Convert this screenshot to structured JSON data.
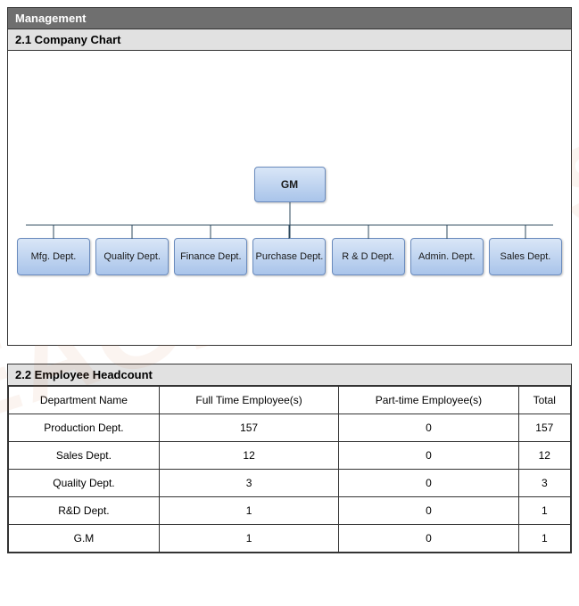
{
  "header": {
    "title": "Management"
  },
  "section_chart": {
    "title": "2.1 Company Chart",
    "root": "GM",
    "children": [
      "Mfg. Dept.",
      "Quality Dept.",
      "Finance Dept.",
      "Purchase Dept.",
      "R & D Dept.",
      "Admin. Dept.",
      "Sales Dept."
    ]
  },
  "section_headcount": {
    "title": "2.2 Employee Headcount",
    "columns": [
      "Department Name",
      "Full Time Employee(s)",
      "Part-time Employee(s)",
      "Total"
    ],
    "rows": [
      {
        "dept": "Production Dept.",
        "full": 157,
        "part": 0,
        "total": 157
      },
      {
        "dept": "Sales Dept.",
        "full": 12,
        "part": 0,
        "total": 12
      },
      {
        "dept": "Quality Dept.",
        "full": 3,
        "part": 0,
        "total": 3
      },
      {
        "dept": "R&D Dept.",
        "full": 1,
        "part": 0,
        "total": 1
      },
      {
        "dept": "G.M",
        "full": 1,
        "part": 0,
        "total": 1
      }
    ]
  },
  "chart_data": {
    "type": "org",
    "root": {
      "label": "GM"
    },
    "children": [
      {
        "label": "Mfg. Dept."
      },
      {
        "label": "Quality Dept."
      },
      {
        "label": "Finance Dept."
      },
      {
        "label": "Purchase Dept."
      },
      {
        "label": "R & D Dept."
      },
      {
        "label": "Admin. Dept."
      },
      {
        "label": "Sales Dept."
      }
    ]
  }
}
